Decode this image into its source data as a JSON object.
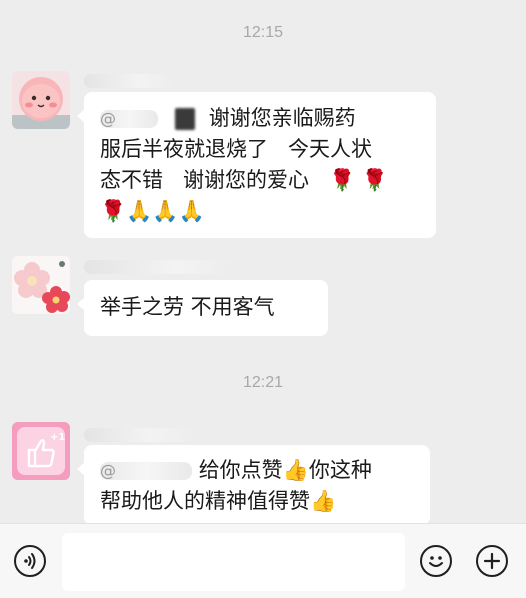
{
  "chat": {
    "timestamps": [
      "12:15",
      "12:21"
    ],
    "messages": [
      {
        "sender_label": "",
        "mention_label": "@",
        "lines": [
          "谢谢您亲临赐药",
          "服后半夜就退烧了   今天人状",
          "态不错   谢谢您的爱心   🌹 🌹",
          "🌹🙏🙏🙏"
        ]
      },
      {
        "sender_label": "",
        "lines": [
          "举手之劳 不用客气"
        ]
      },
      {
        "sender_label": "",
        "mention_label": "@",
        "lines": [
          "给你点赞👍你这种",
          "帮助他人的精神值得赞👍"
        ]
      }
    ]
  },
  "input_bar": {
    "voice_icon": "voice-icon",
    "emoji_icon": "emoji-icon",
    "add_icon": "plus-icon",
    "message_value": ""
  },
  "colors": {
    "background": "#ededed",
    "bubble": "#ffffff",
    "timestamp_text": "#a8a8a8"
  }
}
